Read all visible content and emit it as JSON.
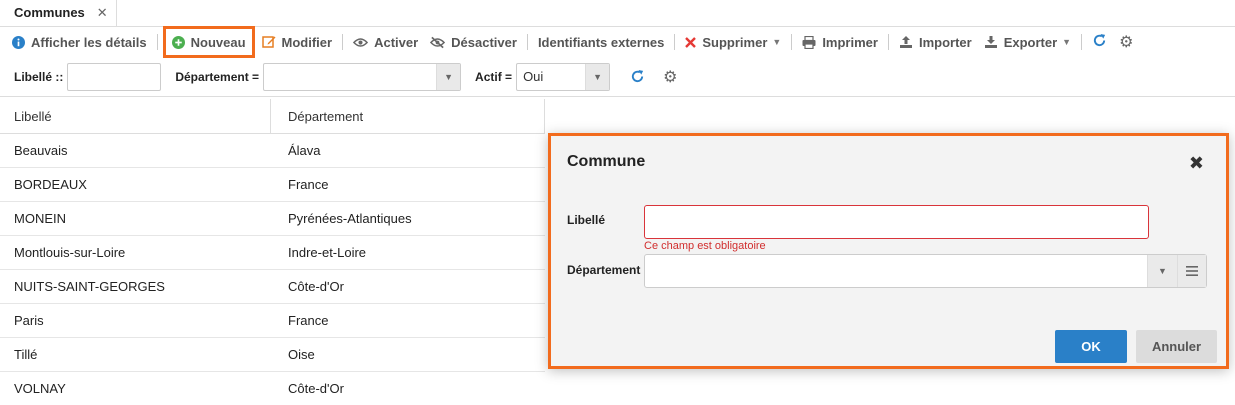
{
  "tab": {
    "label": "Communes",
    "close": "✕"
  },
  "toolbar": {
    "details": "Afficher les détails",
    "new": "Nouveau",
    "edit": "Modifier",
    "activate": "Activer",
    "deactivate": "Désactiver",
    "external_ids": "Identifiants externes",
    "delete": "Supprimer",
    "print": "Imprimer",
    "import": "Importer",
    "export": "Exporter"
  },
  "filters": {
    "libelle_label": "Libellé ::",
    "libelle_value": "",
    "departement_label": "Département =",
    "departement_value": "",
    "actif_label": "Actif =",
    "actif_value": "Oui"
  },
  "grid": {
    "headers": [
      "Libellé",
      "Département"
    ],
    "rows": [
      {
        "libelle": "Beauvais",
        "departement": "Álava"
      },
      {
        "libelle": "BORDEAUX",
        "departement": "France"
      },
      {
        "libelle": "MONEIN",
        "departement": "Pyrénées-Atlantiques"
      },
      {
        "libelle": "Montlouis-sur-Loire",
        "departement": "Indre-et-Loire"
      },
      {
        "libelle": "NUITS-SAINT-GEORGES",
        "departement": "Côte-d'Or"
      },
      {
        "libelle": "Paris",
        "departement": "France"
      },
      {
        "libelle": "Tillé",
        "departement": "Oise"
      },
      {
        "libelle": "VOLNAY",
        "departement": "Côte-d'Or"
      }
    ]
  },
  "modal": {
    "title": "Commune",
    "close": "✖",
    "libelle_label": "Libellé",
    "libelle_value": "",
    "error": "Ce champ est obligatoire",
    "departement_label": "Département",
    "departement_value": "",
    "ok": "OK",
    "cancel": "Annuler"
  },
  "colors": {
    "highlight": "#f26b1d",
    "primary": "#2a80c8",
    "error": "#d12e2e",
    "info": "#2a80c8",
    "add": "#4caf50",
    "edit": "#e67e22",
    "delete": "#e53935"
  }
}
